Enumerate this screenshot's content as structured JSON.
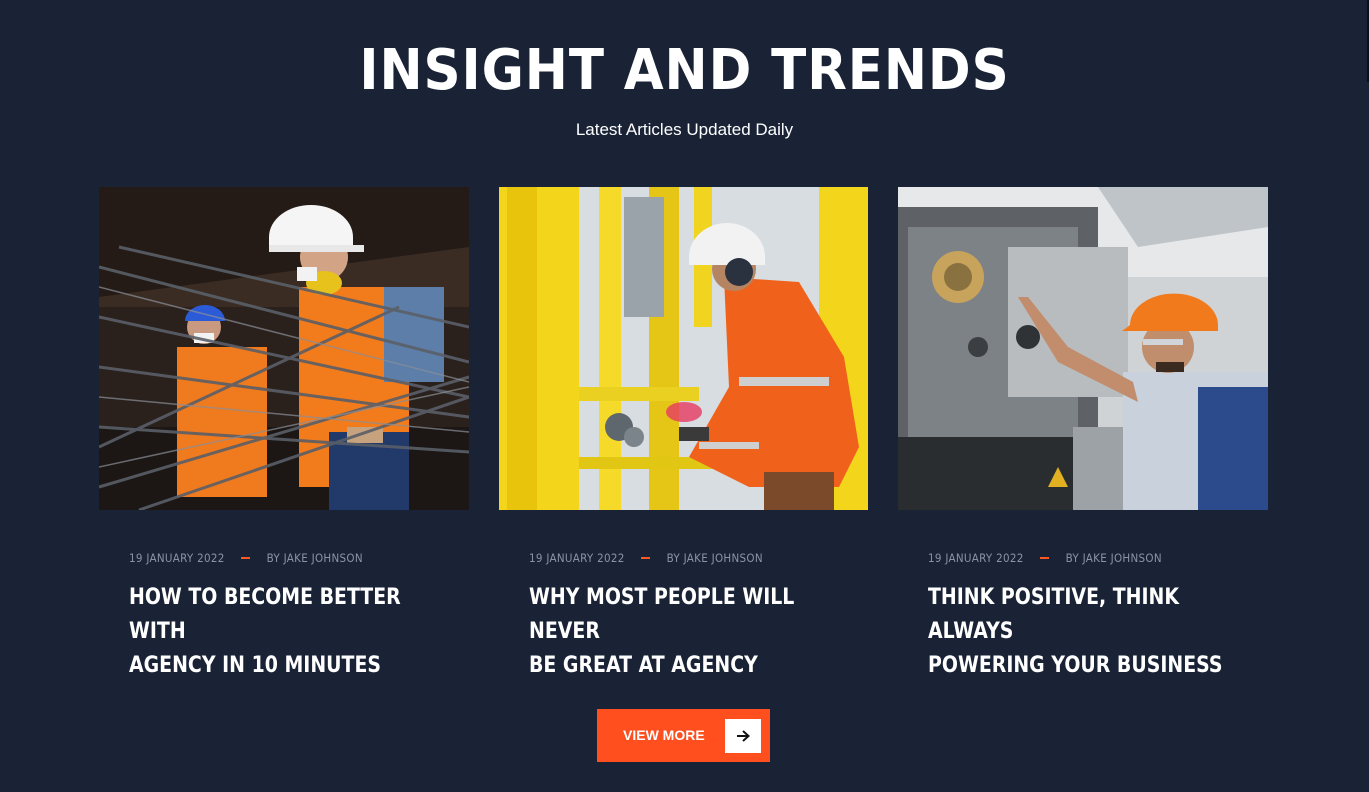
{
  "section": {
    "heading": "INSIGHT AND TRENDS",
    "subheading": "Latest Articles Updated Daily"
  },
  "articles": [
    {
      "date": "19 JANUARY 2022",
      "author": "BY JAKE JOHNSON",
      "title_line1": "HOW TO BECOME BETTER WITH",
      "title_line2": "AGENCY IN 10 MINUTES"
    },
    {
      "date": "19 JANUARY 2022",
      "author": "BY JAKE JOHNSON",
      "title_line1": "WHY MOST PEOPLE WILL NEVER",
      "title_line2": "BE GREAT AT AGENCY"
    },
    {
      "date": "19 JANUARY 2022",
      "author": "BY JAKE JOHNSON",
      "title_line1": "THINK POSITIVE, THINK ALWAYS",
      "title_line2": "POWERING YOUR BUSINESS"
    }
  ],
  "cta": {
    "label": "VIEW MORE",
    "icon": "arrow-right-icon"
  },
  "colors": {
    "background": "#1a2336",
    "accent": "#ff4f1f",
    "meta_text": "#8b93a6",
    "text": "#ffffff"
  }
}
